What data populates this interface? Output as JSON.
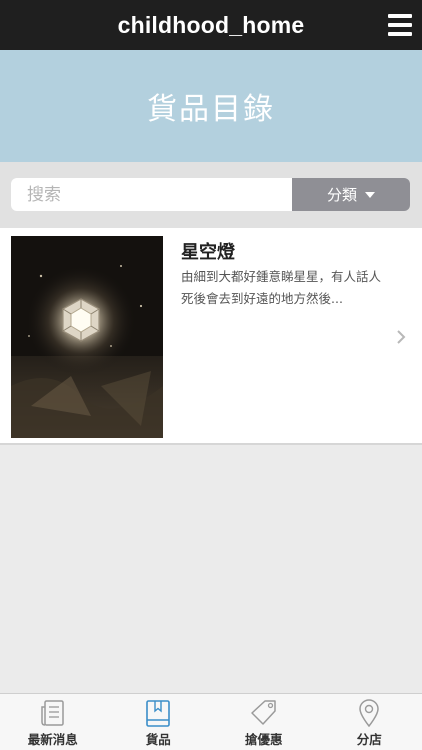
{
  "header": {
    "title": "childhood_home",
    "menu_icon": "hamburger-menu-icon"
  },
  "banner": {
    "heading": "貨品目錄"
  },
  "search": {
    "placeholder": "搜索",
    "category_label": "分類"
  },
  "products": [
    {
      "name": "星空燈",
      "description": "由細到大都好鍾意睇星星，有人話人死後會去到好遠的地方然後..."
    }
  ],
  "tabs": [
    {
      "label": "最新消息",
      "icon": "newspaper-icon",
      "active": false
    },
    {
      "label": "貨品",
      "icon": "book-icon",
      "active": true
    },
    {
      "label": "搶優惠",
      "icon": "tag-icon",
      "active": false
    },
    {
      "label": "分店",
      "icon": "map-pin-icon",
      "active": false
    }
  ],
  "colors": {
    "header_bg": "#1f1f1f",
    "banner_bg": "#b3d0de",
    "active_tab": "#3a8ec9",
    "inactive_tab": "#9a9a9a"
  }
}
